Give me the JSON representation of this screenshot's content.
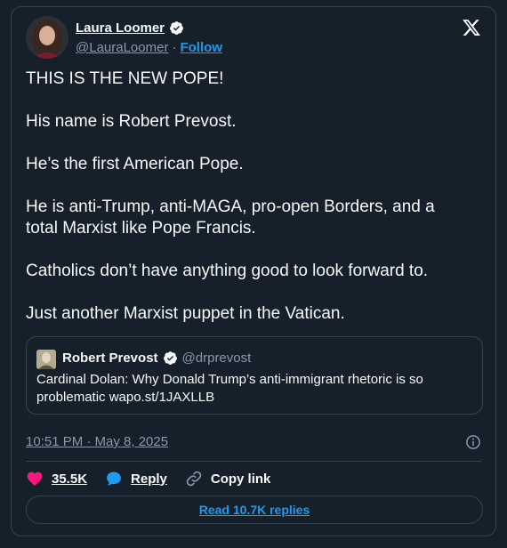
{
  "author": {
    "name": "Laura Loomer",
    "handle": "@LauraLoomer",
    "separator": "·",
    "follow_label": "Follow"
  },
  "tweet": {
    "paragraphs": [
      "THIS IS THE NEW POPE!",
      "His name is Robert Prevost.",
      "He’s the first American Pope.",
      "He is anti-Trump, anti-MAGA, pro-open Borders, and a total Marxist like Pope Francis.",
      "Catholics don’t have anything good to look forward to.",
      "Just another Marxist puppet in the Vatican."
    ]
  },
  "quote": {
    "name": "Robert Prevost",
    "handle": "@drprevost",
    "text": "Cardinal Dolan: Why Donald Trump’s anti-immigrant rhetoric is so problematic wapo.st/1JAXLLB"
  },
  "timestamp": "10:51 PM · May 8, 2025",
  "actions": {
    "likes": "35.5K",
    "reply_label": "Reply",
    "copy_label": "Copy link"
  },
  "read_replies_label": "Read 10.7K replies",
  "colors": {
    "background": "#15202b",
    "border": "#38444d",
    "accent": "#1d9bf0",
    "like": "#f91880",
    "muted": "#8b98a5"
  },
  "icons": [
    "verified-badge-icon",
    "x-logo-icon",
    "info-icon",
    "heart-icon",
    "reply-bubble-icon",
    "link-icon"
  ]
}
